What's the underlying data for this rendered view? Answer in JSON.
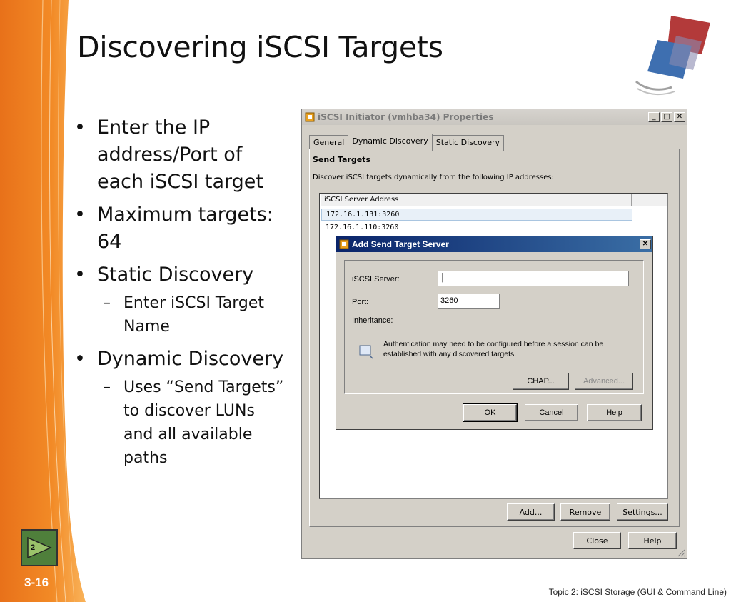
{
  "slide": {
    "title": "Discovering iSCSI Targets",
    "bullets": [
      {
        "text": "Enter the IP address/Port of each iSCSI target"
      },
      {
        "text": "Maximum targets: 64"
      },
      {
        "text": "Static Discovery",
        "sub": "Enter iSCSI Target Name"
      },
      {
        "text": "Dynamic Discovery",
        "sub": "Uses “Send Targets” to discover LUNs and all available paths"
      }
    ],
    "nav_number": "2",
    "slide_number": "3-16",
    "footer": "Topic 2:  iSCSI Storage (GUI & Command Line)"
  },
  "window": {
    "title": "iSCSI Initiator (vmhba34) Properties",
    "controls": {
      "minimize": "_",
      "maximize": "□",
      "close": "✕"
    },
    "tabs": [
      "General",
      "Dynamic Discovery",
      "Static Discovery"
    ],
    "active_tab": "Dynamic Discovery",
    "section_title": "Send Targets",
    "section_desc": "Discover iSCSI targets dynamically from the following IP addresses:",
    "list_header": "iSCSI Server Address",
    "rows": [
      "172.16.1.131:3260",
      "172.16.1.110:3260"
    ],
    "buttons": {
      "add": "Add...",
      "remove": "Remove",
      "settings": "Settings...",
      "close": "Close",
      "help": "Help"
    }
  },
  "subdialog": {
    "title": "Add Send Target Server",
    "close": "✕",
    "server_label": "iSCSI Server:",
    "server_value": "",
    "port_label": "Port:",
    "port_value": "3260",
    "inheritance_label": "Inheritance:",
    "auth_note": "Authentication may need to be configured before a session can be established with any discovered targets.",
    "buttons": {
      "chap": "CHAP...",
      "advanced": "Advanced...",
      "ok": "OK",
      "cancel": "Cancel",
      "help": "Help"
    }
  },
  "colors": {
    "band_orange": "#f07c1f",
    "band_light": "#f9b35a",
    "nav_green": "#4f7f3b",
    "titlebar_blue": "#0a246a"
  }
}
